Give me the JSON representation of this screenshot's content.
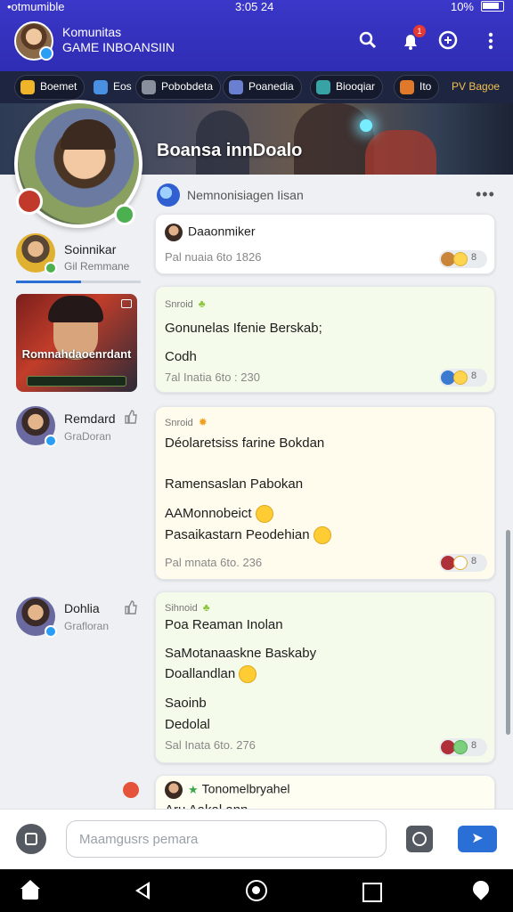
{
  "status_bar": {
    "carrier": "•otmumible",
    "time": "3:05 24",
    "battery": "10%"
  },
  "app": {
    "title_line1": "Komunitas",
    "title_line2": "GAME INBOANSIIN",
    "notification_count": "1"
  },
  "game_tabs": [
    {
      "label": "Boemet",
      "color": "#f0b429"
    },
    {
      "label": "Eos",
      "color": "#4a90e2"
    },
    {
      "label": "Pobobdeta",
      "color": "#8a8f9c"
    },
    {
      "label": "Poanedia",
      "color": "#6a7fd0"
    },
    {
      "label": "Biooqiar",
      "color": "#38a3a5"
    },
    {
      "label": "Ito",
      "color": "#e07a2a"
    },
    {
      "label": "PV Bagoe",
      "color": "#d9a030"
    }
  ],
  "banner": {
    "title": "Boansa innDoalo"
  },
  "sidebar": {
    "user": {
      "name": "Soinnikar",
      "sub": "Gil Remmane",
      "progress": 0.52
    },
    "featured": {
      "caption": "Romnahdaoenrdant"
    },
    "members": [
      {
        "name": "Remdard",
        "sub": "GraDoran"
      },
      {
        "name": "Dohlia",
        "sub": "Grafloran"
      }
    ]
  },
  "feed": {
    "header": "Nemnonisiagen Iisan",
    "posts": [
      {
        "author": "Daaonmiker",
        "lines": [
          "Pal nuaia 6to 1826"
        ],
        "meta": "",
        "reactions": "8"
      },
      {
        "author": "Snroid",
        "lines": [
          "Gonunelas Ifenie Berskab;",
          "Codh"
        ],
        "meta": "7al Inatia 6to : 230",
        "reactions": "8"
      },
      {
        "author": "Snroid",
        "lines": [
          "Déolaretsiss farine Bokdan",
          "Ramensaslan Pabokan",
          "AAMonnobeict",
          "Pasaikastarn Peodehian"
        ],
        "meta": "Pal mnata 6to. 236",
        "reactions": "8"
      },
      {
        "author": "Sihnoid",
        "lines": [
          "Poa Reaman Inolan",
          "SaMotanaaskne Baskaby",
          "Doallandlan",
          "Saoinb",
          "Dedolal"
        ],
        "meta": "Sal Inata 6to. 276",
        "reactions": "8"
      },
      {
        "author": "Tonomelbryahel",
        "lines": [
          "Aru Aakal ann"
        ],
        "meta": "",
        "reactions": ""
      }
    ]
  },
  "composer": {
    "placeholder": "Maamgusrs pemara"
  }
}
